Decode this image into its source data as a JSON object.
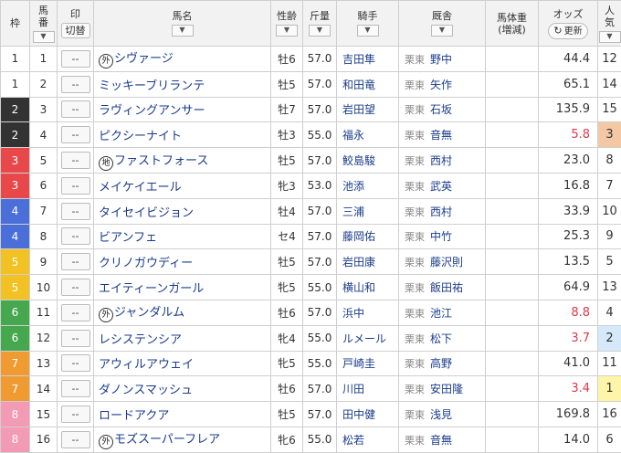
{
  "header": {
    "waku": "枠",
    "umaban": [
      "馬",
      "番"
    ],
    "sort_icon": "chevron-down-icon",
    "mark": "印",
    "mark_toggle": "切替",
    "horse_name": "馬名",
    "sex_age": "性齢",
    "weight": "斤量",
    "jockey": "騎手",
    "trainer": "厩舎",
    "body_weight": [
      "馬体重",
      "(増減)"
    ],
    "odds": "オッズ",
    "refresh_icon": "↻",
    "refresh": "更新",
    "popularity": [
      "人",
      "気"
    ]
  },
  "colors": {
    "waku": {
      "1": "#ffffff",
      "2": "#333333",
      "3": "#e8484a",
      "4": "#4a6fd8",
      "5": "#f2c224",
      "6": "#46a84e",
      "7": "#f09a32",
      "8": "#f39ab4"
    },
    "waku_text": {
      "1": "#333333",
      "2": "#ffffff",
      "3": "#ffffff",
      "4": "#ffffff",
      "5": "#ffffff",
      "6": "#ffffff",
      "7": "#ffffff",
      "8": "#ffffff"
    },
    "pop_highlight": {
      "1": "#fff5a8",
      "2": "#d6e9fb",
      "3": "#f4c8a4"
    }
  },
  "rows": [
    {
      "waku": "1",
      "num": "1",
      "mark": "--",
      "prefix": "外",
      "name": "シヴァージ",
      "sexage": "牡6",
      "weight": "57.0",
      "jockey": "吉田隼",
      "region": "栗東",
      "trainer": "野中",
      "bw": "",
      "odds": "44.4",
      "hot": false,
      "pop": "12"
    },
    {
      "waku": "1",
      "num": "2",
      "mark": "--",
      "prefix": "",
      "name": "ミッキーブリランテ",
      "sexage": "牡5",
      "weight": "57.0",
      "jockey": "和田竜",
      "region": "栗東",
      "trainer": "矢作",
      "bw": "",
      "odds": "65.1",
      "hot": false,
      "pop": "14"
    },
    {
      "waku": "2",
      "num": "3",
      "mark": "--",
      "prefix": "",
      "name": "ラヴィングアンサー",
      "sexage": "牡7",
      "weight": "57.0",
      "jockey": "岩田望",
      "region": "栗東",
      "trainer": "石坂",
      "bw": "",
      "odds": "135.9",
      "hot": false,
      "pop": "15"
    },
    {
      "waku": "2",
      "num": "4",
      "mark": "--",
      "prefix": "",
      "name": "ピクシーナイト",
      "sexage": "牡3",
      "weight": "55.0",
      "jockey": "福永",
      "region": "栗東",
      "trainer": "音無",
      "bw": "",
      "odds": "5.8",
      "hot": true,
      "pop": "3"
    },
    {
      "waku": "3",
      "num": "5",
      "mark": "--",
      "prefix": "地",
      "name": "ファストフォース",
      "sexage": "牡5",
      "weight": "57.0",
      "jockey": "鮫島駿",
      "region": "栗東",
      "trainer": "西村",
      "bw": "",
      "odds": "23.0",
      "hot": false,
      "pop": "8"
    },
    {
      "waku": "3",
      "num": "6",
      "mark": "--",
      "prefix": "",
      "name": "メイケイエール",
      "sexage": "牝3",
      "weight": "53.0",
      "jockey": "池添",
      "region": "栗東",
      "trainer": "武英",
      "bw": "",
      "odds": "16.8",
      "hot": false,
      "pop": "7"
    },
    {
      "waku": "4",
      "num": "7",
      "mark": "--",
      "prefix": "",
      "name": "タイセイビジョン",
      "sexage": "牡4",
      "weight": "57.0",
      "jockey": "三浦",
      "region": "栗東",
      "trainer": "西村",
      "bw": "",
      "odds": "33.9",
      "hot": false,
      "pop": "10"
    },
    {
      "waku": "4",
      "num": "8",
      "mark": "--",
      "prefix": "",
      "name": "ビアンフェ",
      "sexage": "セ4",
      "weight": "57.0",
      "jockey": "藤岡佑",
      "region": "栗東",
      "trainer": "中竹",
      "bw": "",
      "odds": "25.3",
      "hot": false,
      "pop": "9"
    },
    {
      "waku": "5",
      "num": "9",
      "mark": "--",
      "prefix": "",
      "name": "クリノガウディー",
      "sexage": "牡5",
      "weight": "57.0",
      "jockey": "岩田康",
      "region": "栗東",
      "trainer": "藤沢則",
      "bw": "",
      "odds": "13.5",
      "hot": false,
      "pop": "5"
    },
    {
      "waku": "5",
      "num": "10",
      "mark": "--",
      "prefix": "",
      "name": "エイティーンガール",
      "sexage": "牝5",
      "weight": "55.0",
      "jockey": "横山和",
      "region": "栗東",
      "trainer": "飯田祐",
      "bw": "",
      "odds": "64.9",
      "hot": false,
      "pop": "13"
    },
    {
      "waku": "6",
      "num": "11",
      "mark": "--",
      "prefix": "外",
      "name": "ジャンダルム",
      "sexage": "牡6",
      "weight": "57.0",
      "jockey": "浜中",
      "region": "栗東",
      "trainer": "池江",
      "bw": "",
      "odds": "8.8",
      "hot": true,
      "pop": "4"
    },
    {
      "waku": "6",
      "num": "12",
      "mark": "--",
      "prefix": "",
      "name": "レシステンシア",
      "sexage": "牝4",
      "weight": "55.0",
      "jockey": "ルメール",
      "region": "栗東",
      "trainer": "松下",
      "bw": "",
      "odds": "3.7",
      "hot": true,
      "pop": "2"
    },
    {
      "waku": "7",
      "num": "13",
      "mark": "--",
      "prefix": "",
      "name": "アウィルアウェイ",
      "sexage": "牝5",
      "weight": "55.0",
      "jockey": "戸崎圭",
      "region": "栗東",
      "trainer": "高野",
      "bw": "",
      "odds": "41.0",
      "hot": false,
      "pop": "11"
    },
    {
      "waku": "7",
      "num": "14",
      "mark": "--",
      "prefix": "",
      "name": "ダノンスマッシュ",
      "sexage": "牡6",
      "weight": "57.0",
      "jockey": "川田",
      "region": "栗東",
      "trainer": "安田隆",
      "bw": "",
      "odds": "3.4",
      "hot": true,
      "pop": "1"
    },
    {
      "waku": "8",
      "num": "15",
      "mark": "--",
      "prefix": "",
      "name": "ロードアクア",
      "sexage": "牡5",
      "weight": "57.0",
      "jockey": "田中健",
      "region": "栗東",
      "trainer": "浅見",
      "bw": "",
      "odds": "169.8",
      "hot": false,
      "pop": "16"
    },
    {
      "waku": "8",
      "num": "16",
      "mark": "--",
      "prefix": "外",
      "name": "モズスーパーフレア",
      "sexage": "牝6",
      "weight": "55.0",
      "jockey": "松若",
      "region": "栗東",
      "trainer": "音無",
      "bw": "",
      "odds": "14.0",
      "hot": false,
      "pop": "6"
    }
  ]
}
